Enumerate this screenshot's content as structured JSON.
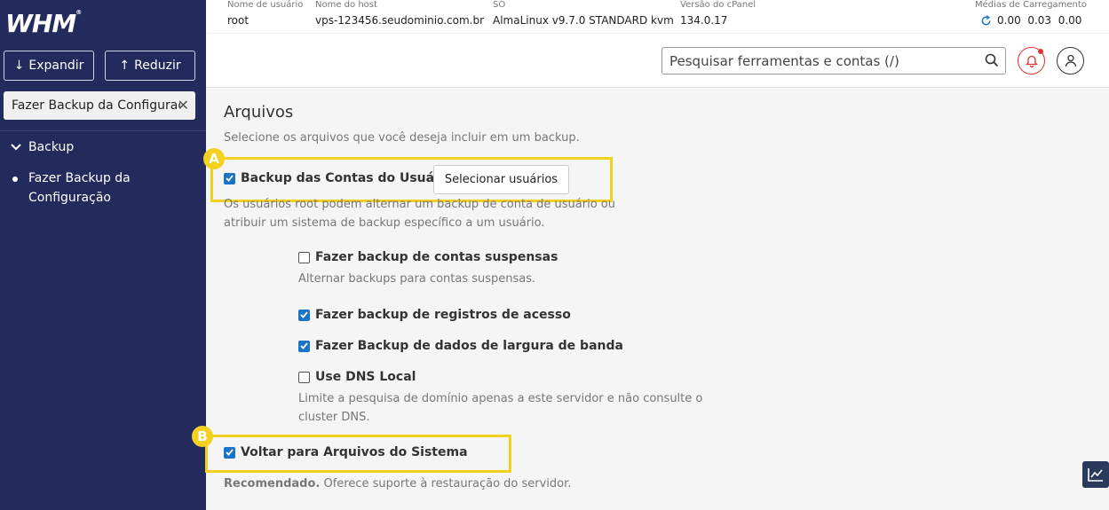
{
  "sidebar": {
    "logo": "WHM",
    "expand_label": "Expandir",
    "reduce_label": "Reduzir",
    "search_value": "Fazer Backup da Configuração",
    "section": "Backup",
    "item_line1": "Fazer Backup da",
    "item_line2": "Configuração"
  },
  "header": {
    "username_label": "Nome de usuário",
    "username": "root",
    "hostname_label": "Nome do host",
    "hostname": "vps-123456.seudominio.com.br",
    "os_label": "SO",
    "os": "AlmaLinux v9.7.0 STANDARD kvm",
    "cpanel_label": "Versão do cPanel",
    "cpanel": "134.0.17",
    "load_label": "Médias de Carregamento",
    "load_values": "0.00  0.03  0.00",
    "search_placeholder": "Pesquisar ferramentas e contas (/)"
  },
  "content": {
    "title": "Arquivos",
    "description": "Selecione os arquivos que você deseja incluir em um backup.",
    "user_accounts_label": "Backup das Contas do Usuário",
    "select_users_label": "Selecionar usuários",
    "user_accounts_help_1": "Os usuários root podem alternar um backup de conta de usuário ou",
    "user_accounts_help_2": "atribuir um sistema de backup específico a um usuário.",
    "suspended_label": "Fazer backup de contas suspensas",
    "suspended_help": "Alternar backups para contas suspensas.",
    "access_logs_label": "Fazer backup de registros de acesso",
    "bandwidth_label": "Fazer Backup de dados de largura de banda",
    "local_dns_label": "Use DNS Local",
    "local_dns_help_1": "Limite a pesquisa de domínio apenas a este servidor e não consulte o",
    "local_dns_help_2": "cluster DNS.",
    "system_files_label": "Voltar para Arquivos do Sistema",
    "recommended": "Recomendado.",
    "system_files_help": " Oferece suporte à restauração do servidor.",
    "marker_a": "A",
    "marker_b": "B"
  },
  "colors": {
    "sidebar_bg": "#232a5c",
    "checkbox_on": "#1a73c4",
    "highlight": "#f2d21f"
  }
}
